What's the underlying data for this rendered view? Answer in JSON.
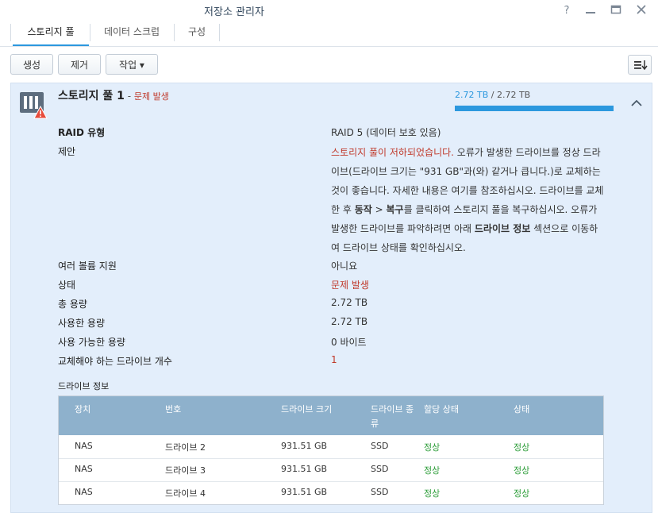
{
  "window": {
    "title": "저장소 관리자"
  },
  "tabs": [
    {
      "label": "스토리지 풀",
      "active": true
    },
    {
      "label": "데이터 스크럽",
      "active": false
    },
    {
      "label": "구성",
      "active": false
    }
  ],
  "toolbar": {
    "create": "생성",
    "remove": "제거",
    "action": "작업 ▾"
  },
  "pool": {
    "name": "스토리지 풀 1",
    "separator": " - ",
    "status_badge": "문제 발생",
    "used": "2.72 TB",
    "usage_separator": " / ",
    "total": "2.72 TB",
    "usage_fraction": 1.0
  },
  "props": {
    "raid_type": {
      "label": "RAID 유형",
      "value": "RAID 5 (데이터 보호 있음)"
    },
    "suggestion": {
      "label": "제안",
      "part1_red": "스토리지 풀이 저하되었습니다.",
      "part2": " 오류가 발생한 드라이브를 정상 드라이브(드라이브 크기는 \"931 GB\"과(와) 같거나 큽니다.)로 교체하는 것이 좋습니다. 자세한 내용은 여기를 참조하십시오. 드라이브를 교체한 후 ",
      "bold1": "동작",
      "part3": " > ",
      "bold2": "복구",
      "part4": "를 클릭하여 스토리지 풀을 복구하십시오. 오류가 발생한 드라이브를 파악하려면 아래 ",
      "bold3": "드라이브 정보",
      "part5": " 섹션으로 이동하여 드라이브 상태를 확인하십시오."
    },
    "multi_volume": {
      "label": "여러 볼륨 지원",
      "value": "아니요"
    },
    "status": {
      "label": "상태",
      "value": "문제 발생"
    },
    "total_capacity": {
      "label": "총 용량",
      "value": "2.72 TB"
    },
    "used_capacity": {
      "label": "사용한 용량",
      "value": "2.72 TB"
    },
    "available_capacity": {
      "label": "사용 가능한 용량",
      "value": "0 바이트"
    },
    "drives_to_replace": {
      "label": "교체해야 하는 드라이브 개수",
      "value": "1"
    }
  },
  "drive_info": {
    "title": "드라이브 정보",
    "columns": [
      "장치",
      "번호",
      "드라이브 크기",
      "드라이브 종류",
      "할당 상태",
      "상태"
    ],
    "rows": [
      {
        "device": "NAS",
        "number": "드라이브 2",
        "size": "931.51 GB",
        "type": "SSD",
        "allocation": "정상",
        "status": "정상"
      },
      {
        "device": "NAS",
        "number": "드라이브 3",
        "size": "931.51 GB",
        "type": "SSD",
        "allocation": "정상",
        "status": "정상"
      },
      {
        "device": "NAS",
        "number": "드라이브 4",
        "size": "931.51 GB",
        "type": "SSD",
        "allocation": "정상",
        "status": "정상"
      }
    ]
  },
  "colors": {
    "accent": "#2c98de",
    "error": "#c0392b",
    "ok": "#2e9e3a",
    "panel_bg": "#e3eefb",
    "table_header": "#8eb1cc"
  },
  "icons": [
    "help-icon",
    "minimize-icon",
    "maximize-icon",
    "close-icon",
    "sort-icon",
    "storage-pool-icon",
    "warning-icon",
    "chevron-up-icon"
  ]
}
